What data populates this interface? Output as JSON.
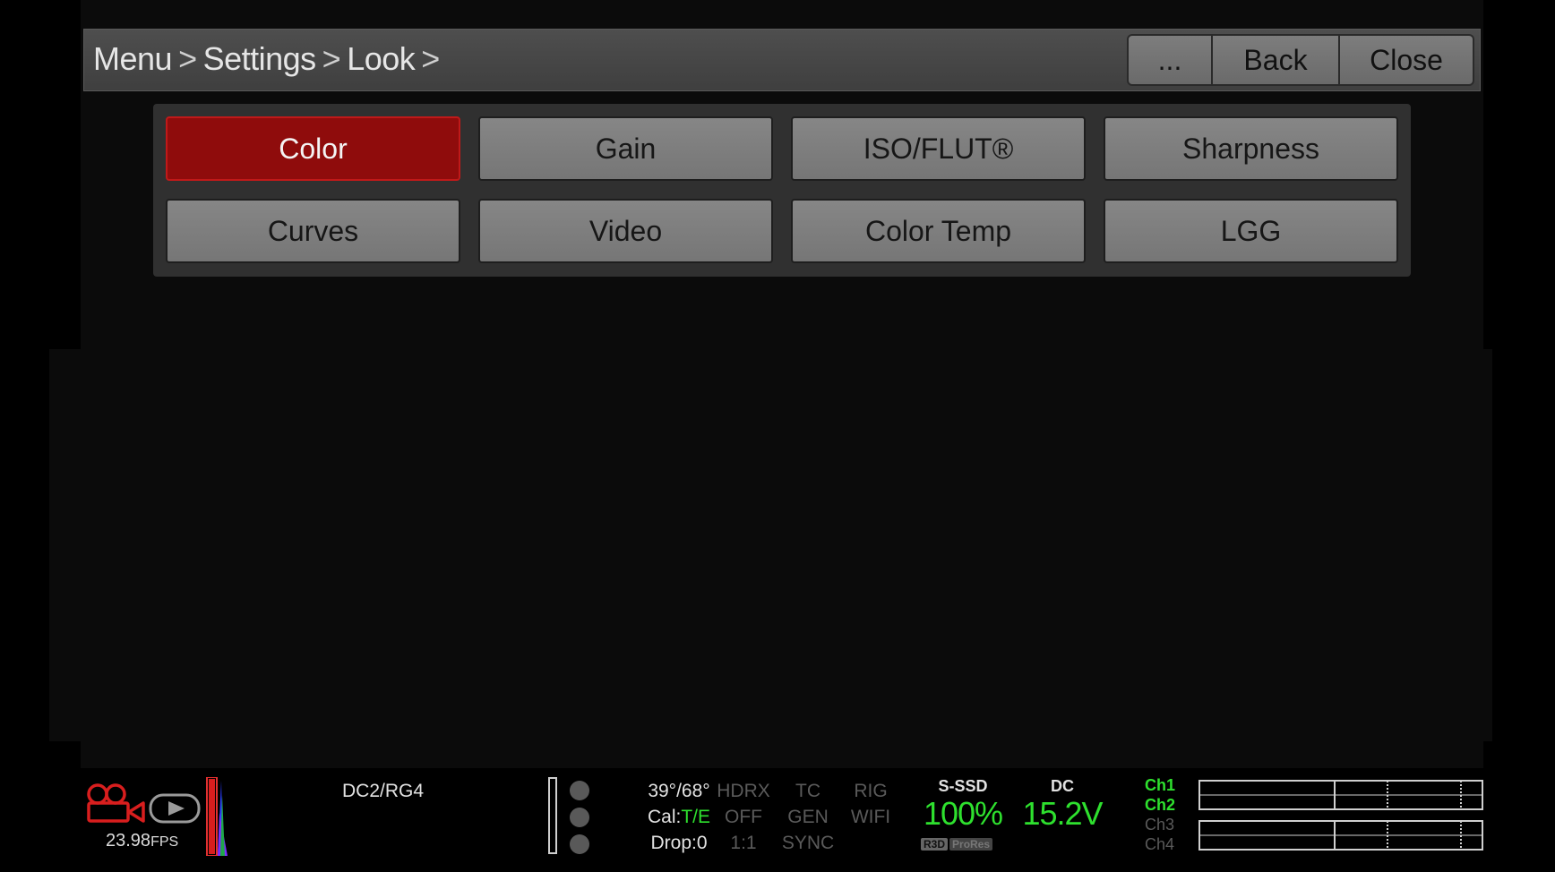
{
  "breadcrumb": [
    "Menu",
    "Settings",
    "Look"
  ],
  "breadcrumb_separator": ">",
  "header_buttons": {
    "more": "...",
    "back": "Back",
    "close": "Close"
  },
  "tiles": [
    {
      "label": "Color",
      "active": true
    },
    {
      "label": "Gain",
      "active": false
    },
    {
      "label": "ISO/FLUT®",
      "active": false
    },
    {
      "label": "Sharpness",
      "active": false
    },
    {
      "label": "Curves",
      "active": false
    },
    {
      "label": "Video",
      "active": false
    },
    {
      "label": "Color Temp",
      "active": false
    },
    {
      "label": "LGG",
      "active": false
    }
  ],
  "status": {
    "fps_value": "23.98",
    "fps_unit": "FPS",
    "color_mode": "DC2/RG4",
    "temp": "39°/68°",
    "cal_label": "Cal:",
    "cal_value": "T/E",
    "drop": "Drop:0",
    "hdrx": [
      "HDRX",
      "OFF",
      "1:1"
    ],
    "tc": [
      "TC",
      "GEN",
      "SYNC"
    ],
    "rig": [
      "RIG",
      "WIFI"
    ],
    "media_label": "S-SSD",
    "media_value": "100%",
    "media_formats": [
      "R3D",
      "ProRes"
    ],
    "power_label": "DC",
    "power_value": "15.2V",
    "channels": [
      {
        "label": "Ch1",
        "active": true
      },
      {
        "label": "Ch2",
        "active": true
      },
      {
        "label": "Ch3",
        "active": false
      },
      {
        "label": "Ch4",
        "active": false
      }
    ]
  },
  "colors": {
    "accent_red": "#8f0c0c",
    "status_green": "#2ee02e"
  },
  "icons": [
    "record-camera-icon",
    "playback-icon",
    "histogram-icon",
    "status-led-icon"
  ]
}
